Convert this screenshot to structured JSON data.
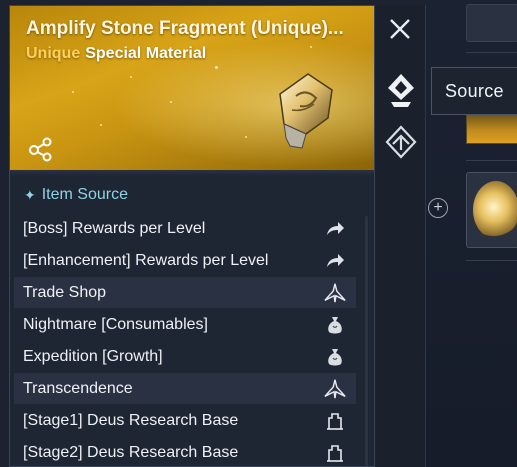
{
  "item": {
    "title": "Amplify Stone Fragment (Unique)...",
    "rarity": "Unique",
    "category": "Special Material"
  },
  "section": {
    "title": "Item Source"
  },
  "sources": [
    {
      "label": "[Boss] Rewards per Level",
      "icon": "arrow-link-icon",
      "highlighted": false
    },
    {
      "label": "[Enhancement] Rewards per Level",
      "icon": "arrow-link-icon",
      "highlighted": false
    },
    {
      "label": "Trade Shop",
      "icon": "trade-shop-icon",
      "highlighted": true
    },
    {
      "label": "Nightmare [Consumables]",
      "icon": "pouch-icon",
      "highlighted": false
    },
    {
      "label": "Expedition [Growth]",
      "icon": "pouch-icon",
      "highlighted": false
    },
    {
      "label": "Transcendence",
      "icon": "trade-shop-icon",
      "highlighted": true
    },
    {
      "label": "[Stage1] Deus Research Base",
      "icon": "stage-gate-icon",
      "highlighted": false
    },
    {
      "label": "[Stage2] Deus Research Base",
      "icon": "stage-gate-icon",
      "highlighted": false
    }
  ],
  "tooltip": {
    "label": "Source"
  },
  "side_icons": [
    "close-icon",
    "source-icon",
    "material-link-icon"
  ],
  "colors": {
    "header_gold": "#d8a418",
    "rarity_gold": "#ffd15a",
    "section_cyan": "#8fd3e6",
    "panel_bg": "#1e2533"
  }
}
